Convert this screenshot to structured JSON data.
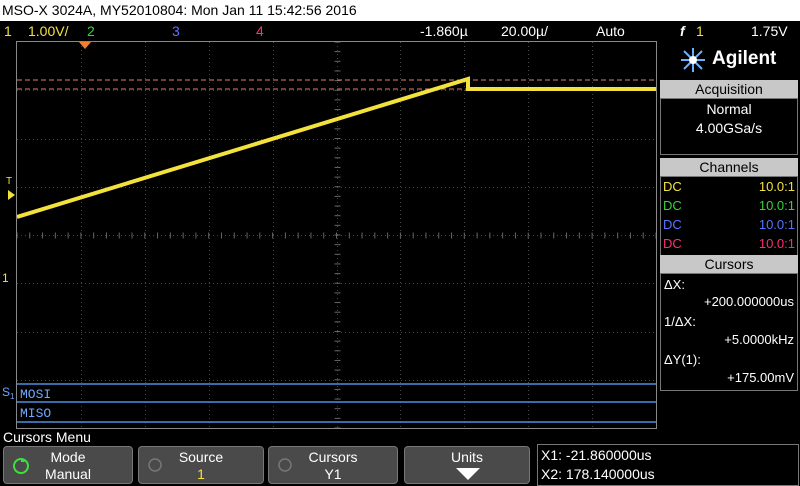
{
  "title": "MSO-X 3024A, MY52010804: Mon Jan 11 15:42:56 2016",
  "status": {
    "ch1_num": "1",
    "ch1_scale": "1.00V/",
    "ch2_num": "2",
    "ch3_num": "3",
    "ch4_num": "4",
    "delay": "-1.860µ",
    "timebase": "20.00µ/",
    "trig_mode": "Auto",
    "trig_glyph": "f",
    "trig_ch": "1",
    "trig_level": "1.75V"
  },
  "screen": {
    "trig_marker": "T",
    "ch1_marker": "1",
    "serial_marker": "S",
    "serial_marker_sub": "1",
    "mosi_label": "MOSI",
    "miso_label": "MISO"
  },
  "panel": {
    "brand": "Agilent",
    "acq_header": "Acquisition",
    "acq_mode": "Normal",
    "acq_rate": "4.00GSa/s",
    "channels_header": "Channels",
    "channels": [
      {
        "coupling": "DC",
        "ratio": "10.0:1",
        "color": "#f4e23c"
      },
      {
        "coupling": "DC",
        "ratio": "10.0:1",
        "color": "#35d43a"
      },
      {
        "coupling": "DC",
        "ratio": "10.0:1",
        "color": "#5a73ff"
      },
      {
        "coupling": "DC",
        "ratio": "10.0:1",
        "color": "#ff2e72"
      }
    ],
    "cursors_header": "Cursors",
    "dx_label": "ΔX:",
    "dx_value": "+200.000000us",
    "inv_dx_label": "1/ΔX:",
    "inv_dx_value": "+5.0000kHz",
    "dy_label": "ΔY(1):",
    "dy_value": "+175.00mV"
  },
  "menu": {
    "title": "Cursors Menu",
    "keys": [
      {
        "top": "Mode",
        "bottom": "Manual"
      },
      {
        "top": "Source",
        "bottom": "1"
      },
      {
        "top": "Cursors",
        "bottom": "Y1"
      },
      {
        "top": "Units",
        "bottom": ""
      }
    ],
    "x1": "X1: -21.860000us",
    "x2": "X2: 178.140000us"
  },
  "colors": {
    "ch1": "#f4e23c",
    "ch2": "#35d43a",
    "ch3": "#5a73ff",
    "ch4": "#ff2e72",
    "cursor": "#e0806a",
    "serial": "#4a8fe0"
  }
}
